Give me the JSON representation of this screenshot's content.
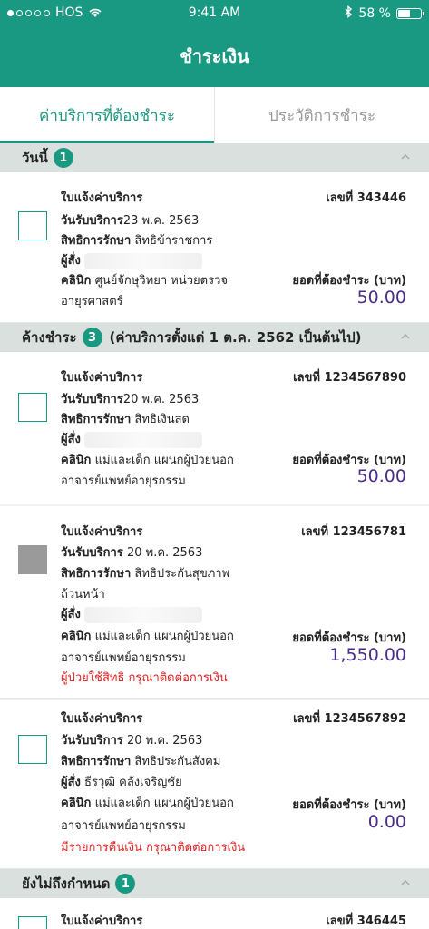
{
  "status_bar": {
    "carrier": "HOS",
    "time": "9:41 AM",
    "battery": "58 %",
    "battery_level": 0.58
  },
  "header": {
    "title": "ชำระเงิน"
  },
  "tabs": [
    {
      "label": "ค่าบริการที่ต้องชำระ",
      "active": true
    },
    {
      "label": "ประวัติการชำระ",
      "active": false
    }
  ],
  "sections": [
    {
      "title": "วันนี้",
      "count": "1",
      "extra": ""
    },
    {
      "title": "ค้างชำระ",
      "count": "3",
      "extra": "(ค่าบริการตั้งแต่ 1 ต.ค. 2562 เป็นต้นไป)"
    },
    {
      "title": "ยังไม่ถึงกำหนด",
      "count": "1",
      "extra": ""
    }
  ],
  "labels": {
    "invoice": "ใบแจ้งค่าบริการ",
    "service_date": "วันรับบริการ",
    "rights": "สิทธิการรักษา",
    "orderer": "ผู้สั่ง",
    "clinic": "คลินิก",
    "due": "ยอดที่ต้องชำระ (บาท)"
  },
  "invoices": [
    {
      "number": "เลขที่ 343446",
      "service_date": "23 พ.ค. 2563",
      "rights": "สิทธิข้าราชการ",
      "orderer": "",
      "clinic_line1": "ศูนย์จักษุวิทยา หน่วยตรวจ",
      "clinic_line2": "อายุรศาสตร์",
      "amount": "50.00",
      "warning": ""
    },
    {
      "number": "เลขที่ 1234567890",
      "service_date": "20 พ.ค. 2563",
      "rights": "สิทธิเงินสด",
      "orderer": "",
      "clinic_line1": "แม่และเด็ก แผนกผู้ป่วยนอก",
      "clinic_line2": "อาจารย์แพทย์อายุรกรรม",
      "amount": "50.00",
      "warning": ""
    },
    {
      "number": "เลขที่ 123456781",
      "service_date": " 20 พ.ค. 2563",
      "rights": "สิทธิประกันสุขภาพ",
      "rights_line2": "ถ้วนหน้า",
      "orderer": "",
      "clinic_line1": "แม่และเด็ก แผนกผู้ป่วยนอก",
      "clinic_line2": "อาจารย์แพทย์อายุรกรรม",
      "amount": "1,550.00",
      "warning": "ผู้ป่วยใช้สิทธิ กรุณาติดต่อการเงิน"
    },
    {
      "number": "เลขที่ 1234567892",
      "service_date": " 20 พ.ค. 2563",
      "rights": "สิทธิประกันสังคม",
      "orderer": "ธีรวุฒิ คลังเจริญชัย",
      "clinic_line1": "แม่และเด็ก แผนกผู้ป่วยนอก",
      "clinic_line2": "อาจารย์แพทย์อายุรกรรม",
      "amount": "0.00",
      "warning": "มีรายการคืนเงิน กรุณาติดต่อการเงิน"
    },
    {
      "number": "เลขที่ 346445"
    }
  ],
  "colors": {
    "brand": "#1a9982",
    "amount": "#4a2d8a",
    "warning": "#e02020"
  }
}
